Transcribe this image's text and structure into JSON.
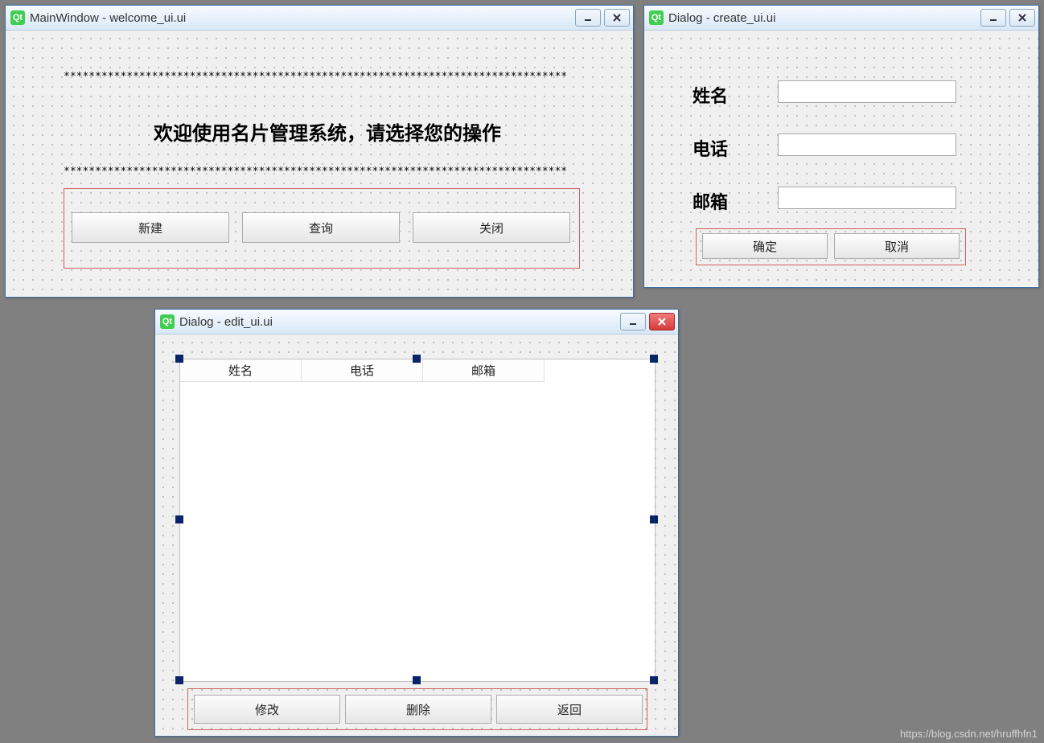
{
  "watermark": "https://blog.csdn.net/hruffhfn1",
  "win1": {
    "title": "MainWindow - welcome_ui.ui",
    "stars_top": "********************************************************************************",
    "heading": "欢迎使用名片管理系统，请选择您的操作",
    "stars_bottom": "********************************************************************************",
    "btn_new": "新建",
    "btn_query": "查询",
    "btn_close": "关闭"
  },
  "win2": {
    "title": "Dialog - create_ui.ui",
    "label_name": "姓名",
    "label_phone": "电话",
    "label_mail": "邮箱",
    "btn_ok": "确定",
    "btn_cancel": "取消"
  },
  "win3": {
    "title": "Dialog - edit_ui.ui",
    "col_name": "姓名",
    "col_phone": "电话",
    "col_mail": "邮箱",
    "btn_modify": "修改",
    "btn_delete": "删除",
    "btn_back": "返回"
  },
  "qt_icon_text": "Qt"
}
